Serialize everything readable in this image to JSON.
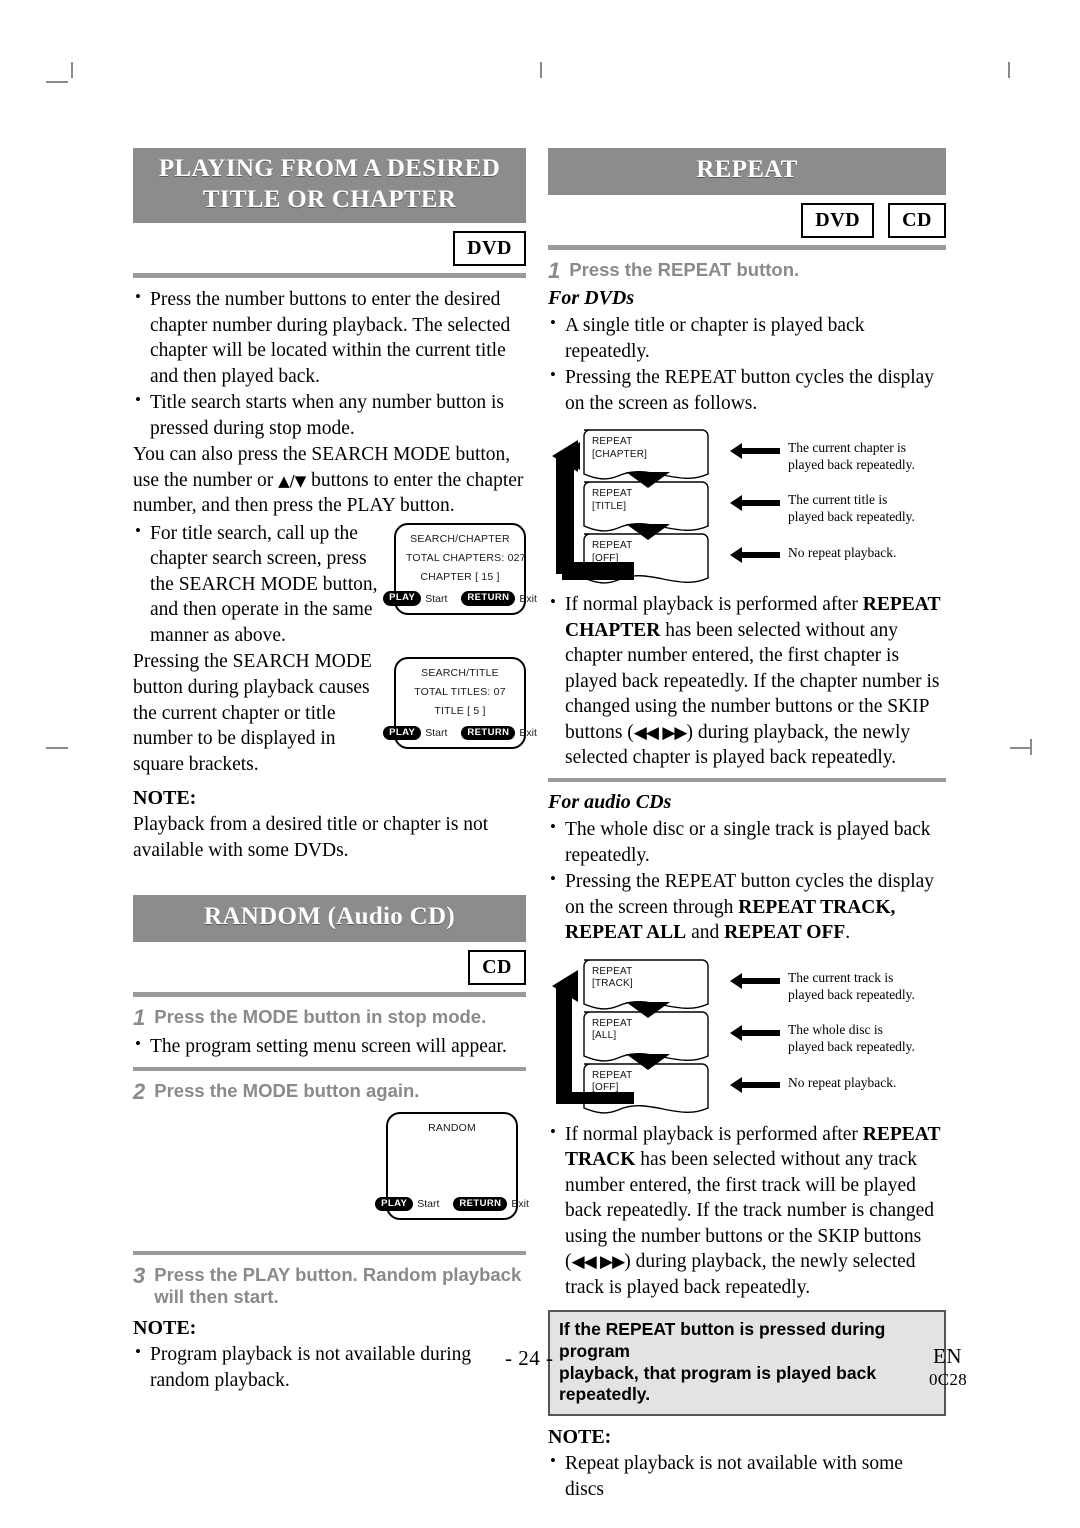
{
  "page": {
    "number_label": "- 24 -",
    "language_code": "EN",
    "doc_code": "0C28"
  },
  "left_column": {
    "section1": {
      "heading_line1": "PLAYING FROM A DESIRED",
      "heading_line2": "TITLE OR CHAPTER",
      "badges": [
        "DVD"
      ],
      "bullets": [
        "Press the number buttons to enter the desired chapter number during playback. The selected chapter will be located within the current title and then played back.",
        "Title search starts when any number button is pressed during stop mode."
      ],
      "paragraph1_a": "You can also press the SEARCH MODE button, use the number or ",
      "paragraph1_glyph": "▲/▼",
      "paragraph1_b": " buttons to enter the chapter number, and then press the PLAY button.",
      "bullet_title_search": "For title search, call up the chapter search screen, press the SEARCH MODE button, and then operate in the same manner as above.",
      "paragraph2": "Pressing the SEARCH MODE button during playback causes the current chapter or title number to be displayed in square brackets.",
      "note_label": "NOTE:",
      "note_text": "Playback from a desired title or chapter is not available with some DVDs.",
      "osd_chapter": {
        "title": "SEARCH/CHAPTER",
        "line2": "TOTAL  CHAPTERS: 027",
        "line3": "CHAPTER  [  15 ]",
        "key1_pill": "PLAY",
        "key1_label": "Start",
        "key2_pill": "RETURN",
        "key2_label": "Exit"
      },
      "osd_title": {
        "title": "SEARCH/TITLE",
        "line2": "TOTAL  TITLES: 07",
        "line3": "TITLE  [  5 ]",
        "key1_pill": "PLAY",
        "key1_label": "Start",
        "key2_pill": "RETURN",
        "key2_label": "Exit"
      }
    },
    "section2": {
      "heading": "RANDOM (Audio CD)",
      "badges": [
        "CD"
      ],
      "step1_num": "1",
      "step1_text": "Press the MODE button in stop mode.",
      "step1_bullet": "The program setting menu screen will appear.",
      "step2_num": "2",
      "step2_text": "Press the MODE button again.",
      "step3_num": "3",
      "step3_text": "Press the PLAY button. Random playback will then start.",
      "note_label": "NOTE:",
      "note_bullet": "Program playback is not available during random playback.",
      "osd_random": {
        "title": "RANDOM",
        "key1_pill": "PLAY",
        "key1_label": "Start",
        "key2_pill": "RETURN",
        "key2_label": "Exit"
      }
    }
  },
  "right_column": {
    "section": {
      "heading": "REPEAT",
      "badges": [
        "DVD",
        "CD"
      ],
      "step1_num": "1",
      "step1_text": "Press the REPEAT button.",
      "for_dvds_label": "For DVDs",
      "dvd_bullets": [
        "A single title or chapter is played back repeatedly.",
        "Pressing the REPEAT button cycles the display on the screen as follows."
      ],
      "dvd_cycle": {
        "box1_line1": "REPEAT",
        "box1_line2": "[CHAPTER]",
        "box1_label_line1": "The current chapter is",
        "box1_label_line2": "played back repeatedly.",
        "box2_line1": "REPEAT",
        "box2_line2": "[TITLE]",
        "box2_label_line1": "The current title is",
        "box2_label_line2": "played back repeatedly.",
        "box3_line1": "REPEAT",
        "box3_line2": "[OFF]",
        "box3_label_line1": "No repeat playback.",
        "box3_label_line2": ""
      },
      "dvd_note_a": "If normal playback is performed after ",
      "dvd_note_bold1": "REPEAT CHAPTER",
      "dvd_note_b": " has been selected without any chapter number entered, the first chapter is played back repeatedly. If the chapter number is changed using the number buttons or the SKIP buttons (",
      "skip_glyph": "◀◀ ▶▶",
      "dvd_note_c": ") during playback, the newly selected chapter is played back repeatedly.",
      "for_cds_label": "For audio CDs",
      "cd_bullets": [
        "The whole disc or a single track is played back repeatedly."
      ],
      "cd_bullet2_a": "Pressing the REPEAT button cycles the display on the screen through ",
      "cd_bullet2_bold1": "REPEAT TRACK, REPEAT ALL",
      "cd_bullet2_mid": " and ",
      "cd_bullet2_bold2": "REPEAT OFF",
      "cd_bullet2_end": ".",
      "cd_cycle": {
        "box1_line1": "REPEAT",
        "box1_line2": "[TRACK]",
        "box1_label_line1": "The current track is",
        "box1_label_line2": "played back repeatedly.",
        "box2_line1": "REPEAT",
        "box2_line2": "[ALL]",
        "box2_label_line1": "The whole disc is",
        "box2_label_line2": "played back repeatedly.",
        "box3_line1": "REPEAT",
        "box3_line2": "[OFF]",
        "box3_label_line1": "No repeat playback.",
        "box3_label_line2": ""
      },
      "cd_note_a": "If normal playback is performed after ",
      "cd_note_bold1": "REPEAT TRACK",
      "cd_note_b": " has been selected without any track number entered, the first track will be played back repeatedly. If the track number is changed using the number buttons or the SKIP buttons (",
      "cd_note_c": ") during playback, the newly selected track is played back repeatedly.",
      "box_note_line1": "If the REPEAT button is pressed during program",
      "box_note_line2": "playback, that program is played back repeatedly.",
      "note_label": "NOTE:",
      "note_bullet": "Repeat playback is not available with some discs"
    }
  },
  "colors": {
    "heading_bar": "#8c8c8c",
    "rule": "#9a9a9a",
    "step_gray": "#8a8a8a",
    "box_note_fill": "#e3e3e3"
  }
}
